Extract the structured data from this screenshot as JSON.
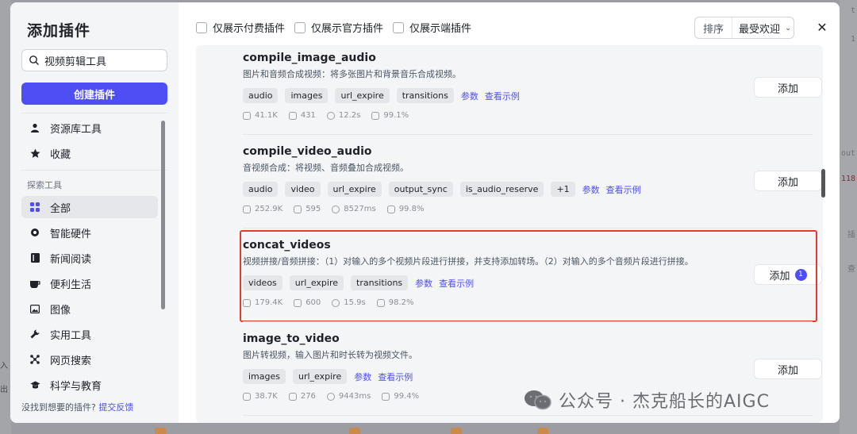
{
  "background": {
    "right_fragments": [
      "t",
      "1",
      "out",
      "118",
      "插",
      "查"
    ],
    "left_fragments": [
      "入",
      "出"
    ]
  },
  "sidebar": {
    "title": "添加插件",
    "search": {
      "value": "视频剪辑工具"
    },
    "create_label": "创建插件",
    "top_items": [
      {
        "label": "资源库工具",
        "icon": "user-icon"
      },
      {
        "label": "收藏",
        "icon": "star-icon"
      }
    ],
    "section_label": "探索工具",
    "items": [
      {
        "label": "全部",
        "icon": "grid-icon",
        "active": true
      },
      {
        "label": "智能硬件",
        "icon": "chip-icon"
      },
      {
        "label": "新闻阅读",
        "icon": "book-icon"
      },
      {
        "label": "便利生活",
        "icon": "cup-icon"
      },
      {
        "label": "图像",
        "icon": "image-icon"
      },
      {
        "label": "实用工具",
        "icon": "wrench-icon"
      },
      {
        "label": "网页搜索",
        "icon": "network-icon"
      },
      {
        "label": "科学与教育",
        "icon": "graduation-icon"
      }
    ],
    "feedback_text": "没找到想要的插件?",
    "feedback_link": "提交反馈"
  },
  "filters": {
    "paid": "仅展示付费插件",
    "official": "仅展示官方插件",
    "client": "仅展示端插件"
  },
  "sort": {
    "label": "排序",
    "value": "最受欢迎"
  },
  "plugins": [
    {
      "name": "compile_image_audio",
      "desc": "图片和音频合成视频：将多张图片和背景音乐合成视频。",
      "tags": [
        "audio",
        "images",
        "url_expire",
        "transitions"
      ],
      "params_link": "参数",
      "example_link": "查看示例",
      "stats": [
        "41.1K",
        "431",
        "12.2s",
        "99.1%"
      ],
      "add_label": "添加"
    },
    {
      "name": "compile_video_audio",
      "desc": "音视频合成：将视频、音频叠加合成视频。",
      "tags": [
        "audio",
        "video",
        "url_expire",
        "output_sync",
        "is_audio_reserve",
        "+1"
      ],
      "params_link": "参数",
      "example_link": "查看示例",
      "stats": [
        "252.9K",
        "595",
        "8527ms",
        "99.8%"
      ],
      "add_label": "添加"
    },
    {
      "name": "concat_videos",
      "desc": "视频拼接/音频拼接：（1）对输入的多个视频片段进行拼接，并支持添加转场。（2）对输入的多个音频片段进行拼接。",
      "tags": [
        "videos",
        "url_expire",
        "transitions"
      ],
      "params_link": "参数",
      "example_link": "查看示例",
      "stats": [
        "179.4K",
        "600",
        "15.9s",
        "98.2%"
      ],
      "add_label": "添加",
      "badge": "1"
    },
    {
      "name": "image_to_video",
      "desc": "图片转视频，输入图片和时长转为视频文件。",
      "tags": [
        "images",
        "url_expire"
      ],
      "params_link": "参数",
      "example_link": "查看示例",
      "stats": [
        "38.7K",
        "276",
        "9443ms",
        "99.4%"
      ],
      "add_label": "添加"
    }
  ],
  "watermark": "公众号 · 杰克船长的AIGC"
}
